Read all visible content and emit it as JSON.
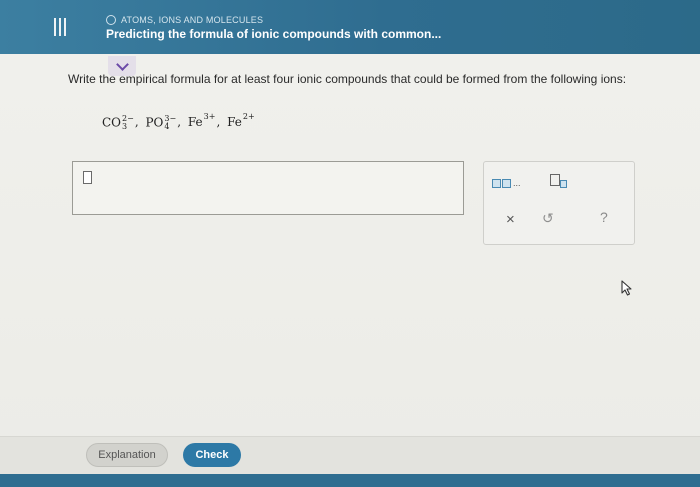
{
  "header": {
    "topic": "ATOMS, IONS AND MOLECULES",
    "title": "Predicting the formula of ionic compounds with common..."
  },
  "question": {
    "text": "Write the empirical formula for at least four ionic compounds that could be formed from the following ions:",
    "ions": [
      {
        "base": "CO",
        "subscript": "3",
        "charge": "2−"
      },
      {
        "base": "PO",
        "subscript": "4",
        "charge": "3−"
      },
      {
        "base": "Fe",
        "subscript": "",
        "charge": "3+"
      },
      {
        "base": "Fe",
        "subscript": "",
        "charge": "2+"
      }
    ],
    "separator": ","
  },
  "answer": {
    "value": ""
  },
  "toolbar": {
    "dots": "...",
    "clear_symbol": "×",
    "undo_symbol": "↺",
    "help_symbol": "?"
  },
  "buttons": {
    "explanation": "Explanation",
    "check": "Check"
  },
  "colors": {
    "header": "#2f6d90",
    "check_button": "#2d79a6",
    "collapse_chevron": "#6b4aa8"
  }
}
